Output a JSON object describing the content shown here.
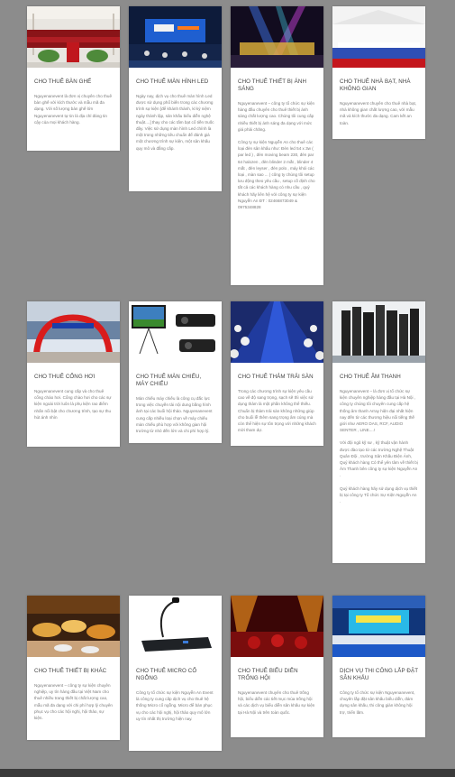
{
  "services": [
    {
      "title": "CHO THUÊ BÀN GHẾ",
      "paragraphs": [
        "Nguyenanevent là đơn vị chuyên cho thuê bàn ghế với kích thước và mẫu mã đa dạng. Với số lượng bàn ghế lớn Nguyenanevent tự tin là địa chỉ đáng tin cậy của mọi khách hàng."
      ]
    },
    {
      "title": "CHO THUÊ MÀN HÌNH LED",
      "paragraphs": [
        "Ngày nay, dịch vụ cho thuê màn hình Led được sử dụng phổ biến trong các chương trình sự kiện [để khánh thành, kỉ kỷ niệm ngày thành lập, sản khấu biểu diễn nghệ thuật....] thay cho các tấm bạt cổ tiền truốc đây. Việc sử dụng màn hình Led chính là một trong những tiêu chuẩn để đánh giá một chương trình sự kiện, một sân khấu quy mô và đẳng cấp."
      ]
    },
    {
      "title": "CHO THUÊ THIẾT BỊ ÁNH SÁNG",
      "paragraphs": [
        "Nguyenanevent – công ty tổ chức sự kiện hàng đầu chuyên cho thuê thiết bị ánh sáng chất lượng cao. Chúng tôi cung cấp nhiều thiết bị ánh sáng đa dạng với mức giá phải chăng.",
        "Công ty sự kiện Nguyễn An cho thuê các loại đèn sân khấu như: Đèn led 54 x 3w ( par led ) , đèn moving beam 230, đèn par 64 halozen , đèn blinder 2 mắt , blinder 4 mắt , đèn leyser , đèn polo , máy khói các loại , màn sao ... | công ty chúng tôi setup lưu động theo yêu cầu , setup cố định cho tất cả các khách hàng có nhu cầu , quý khách hãy liên hệ với công ty sự kiện Nguyễn An ĐT : 02466873049 & 0975348828"
      ]
    },
    {
      "title": "CHO THUÊ NHÀ BẠT, NHÀ KHÔNG GIAN",
      "paragraphs": [
        "Nguyenanevent chuyên cho thuê nhà bạt, nhà không gian chất lượng cao, với mẫu mã và kích thước đa dạng. Cam kết an toàn."
      ]
    },
    {
      "title": "CHO THUÊ CỔNG HƠI",
      "paragraphs": [
        "Nguyenanevent cung cấp và cho thuê cổng chào hơi. Cổng chào hơi cho các sự kiện ngoài trời luôn là phụ kiện rao điểm nhấn nổi bật cho chương trình, tạo sự thu hút ánh nhìn"
      ]
    },
    {
      "title": "CHO THUÊ MÀN CHIẾU, MÁY CHIẾU",
      "paragraphs": [
        "Màn chiếu máy chiếu là công cụ đắc lực trong việc chuyền tải nội dung bằng hình ảnh tại các buổi hội thảo. Nguyenanevent cung cấp nhiều loại chọn về máy chiếu màn chiếu phù hợp với không gian hội trường từ nhỏ đến lớn và chi phí hợp lý."
      ]
    },
    {
      "title": "CHO THUÊ THẢM TRẢI SÀN",
      "paragraphs": [
        "Trong các chương trình sự kiện yêu cầu cao về độ sang trọng, sạch sẽ thì việc sử dụng thảm là một phần không thể thiếu. Chuẩn bị thảm trải sàn không những giúp cho buổi lễ thêm sang trọng âm cúng mà còn thể hiện sự tôn trọng với những khách mời tham dự."
      ]
    },
    {
      "title": "CHO THUÊ ÂM THANH",
      "paragraphs": [
        "Nguyenanevent – là đơn vị tổ chức sự kiện chuyên nghiệp hàng đầu tại Hà Nội , công ty chúng tôi chuyên cung cấp hệ thống âm thanh Array hiện đại nhất hiện nay đến từ các thương hiệu nổi tiếng thế giới như AERO DAS, RCF, AUDIO SENTER , LINE....!",
        "Với đội ngũ kỹ sư , kỹ thuật vận hành được đào tạo từ các trường Nghệ Thuật Quân Đội , trường Sân Khấu Điện Ảnh, Quý khách hàng Có thể yên tâm về thiết bị Âm Thanh bên công ty sự kiện Nguyễn An .",
        "Quý khách hàng hãy sử dụng dịch vụ thiết bị tại công ty Tổ chức Sự Kiện Nguyễn An ."
      ]
    },
    {
      "title": "CHO THUÊ THIẾT BỊ KHÁC",
      "paragraphs": [
        "Nguyenanevent – công ty sự kiện chuyên nghiệp, uy tín hàng đầu tại Việt Nam cho thuê nhiều trang thiết bị chất lượng cao, mẫu mã đa dạng với chi phí hợp lý chuyên phục vụ cho các hội nghị, hội thảo, sự kiện."
      ]
    },
    {
      "title": "CHO THUÊ MICRO CỔ NGỖNG",
      "paragraphs": [
        "Công ty tổ chức sự kiện Nguyễn An Event là công ty cung cấp dịch vụ cho thuê hệ thống Micro cổ ngỗng. Micro để bàn phục vụ cho các hội nghị, hội thảo quy mô lớn uy tín nhất thị trường hiện nay."
      ]
    },
    {
      "title": "CHO THUÊ BIỂU DIỄN TRỐNG HỘI",
      "paragraphs": [
        "Nguyenanevent chuyên cho thuê trống hội, biểu diễn các tiết mục múa trống hội và các dịch vụ biểu diễn sân khấu sự kiện tại Hà Nội và trên toàn quốc."
      ]
    },
    {
      "title": "DỊCH VỤ THI CÔNG LẮP ĐẶT SÂN KHẤU",
      "paragraphs": [
        "Công ty tổ chức sự kiện Nguyenanevent, chuyên lắp đặt sân khấu biểu diễn, đám dựng sân khấu, thi công giàn không hội trợ, triển lãm."
      ]
    }
  ]
}
